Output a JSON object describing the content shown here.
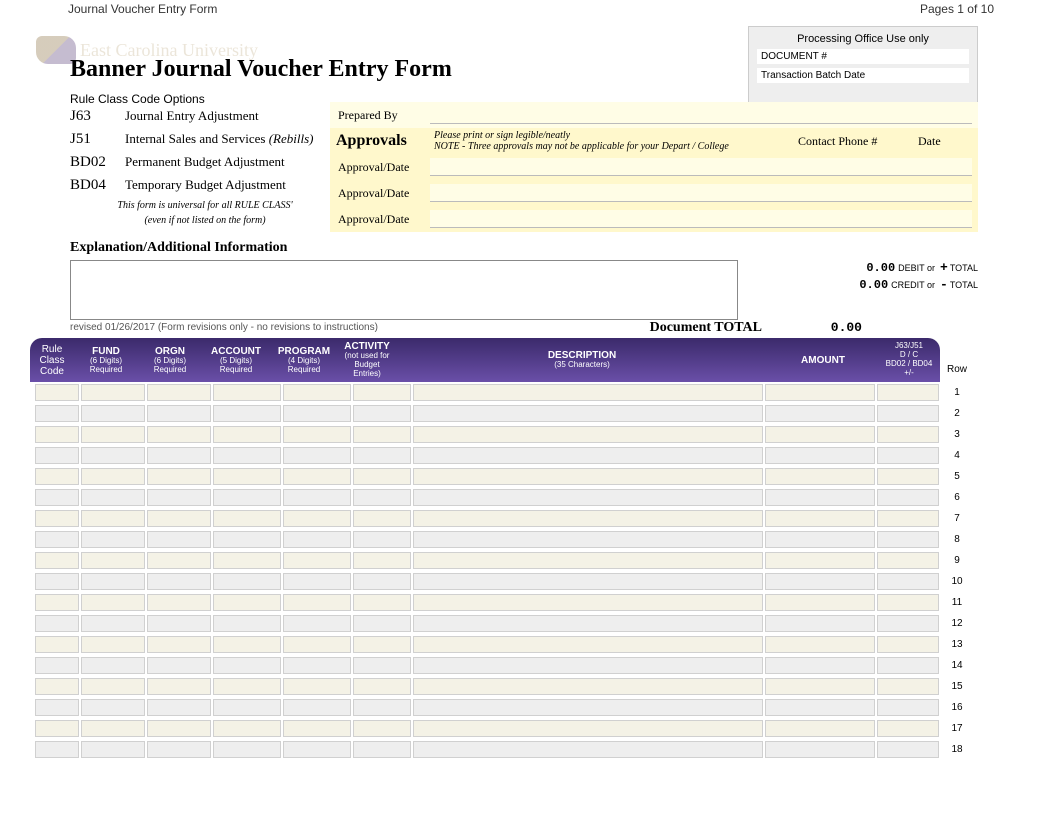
{
  "page_header": {
    "left": "Journal Voucher Entry Form",
    "right": "Pages 1 of 10"
  },
  "university": "East Carolina University",
  "title": "Banner Journal Voucher Entry Form",
  "processing_box": {
    "header": "Processing Office Use only",
    "doc_label": "DOCUMENT #",
    "batch_label": "Transaction Batch Date"
  },
  "rule_options_label": "Rule Class Code Options",
  "rules": [
    {
      "code": "J63",
      "desc": "Journal Entry Adjustment"
    },
    {
      "code": "J51",
      "desc": "Internal Sales and Services",
      "desc_em": "(Rebills)"
    },
    {
      "code": "BD02",
      "desc": "Permanent Budget Adjustment"
    },
    {
      "code": "BD04",
      "desc": "Temporary Budget Adjustment"
    }
  ],
  "rule_note_1": "This form is universal for all RULE CLASS'",
  "rule_note_2": "(even if not listed on the form)",
  "approvals": {
    "prepared_by": "Prepared By",
    "big_label": "Approvals",
    "hint1": "Please print or sign legible/neatly",
    "hint2": "NOTE - Three approvals may not be applicable for your Depart / College",
    "contact": "Contact Phone #",
    "date": "Date",
    "ad": "Approval/Date"
  },
  "explanation_heading": "Explanation/Additional Information",
  "revised": "revised 01/26/2017 (Form revisions only - no revisions to instructions)",
  "totals": {
    "debit_val": "0.00",
    "debit_tag": "DEBIT or",
    "debit_sign": "+",
    "tot_lbl": "TOTAL",
    "credit_val": "0.00",
    "credit_tag": "CREDIT or",
    "credit_sign": "-",
    "doc_total_label": "Document TOTAL",
    "doc_total_val": "0.00"
  },
  "grid": {
    "headers": {
      "rule": {
        "l1": "Rule",
        "l2": "Class",
        "l3": "Code"
      },
      "fund": {
        "t": "FUND",
        "sub": "(6 Digits)",
        "req": "Required"
      },
      "orgn": {
        "t": "ORGN",
        "sub": "(6 Digits)",
        "req": "Required"
      },
      "acct": {
        "t": "ACCOUNT",
        "sub": "(5 Digits)",
        "req": "Required"
      },
      "prog": {
        "t": "PROGRAM",
        "sub": "(4 Digits)",
        "req": "Required"
      },
      "actv": {
        "t": "ACTIVITY",
        "sub1": "(not used for",
        "sub2": "Budget Entries)"
      },
      "desc": {
        "t": "DESCRIPTION",
        "sub": "(35 Characters)"
      },
      "amt": {
        "t": "AMOUNT"
      },
      "dc": {
        "l1": "J63/J51",
        "l2": "D / C",
        "l3": "BD02 / BD04",
        "l4": "+/-"
      },
      "row": "Row"
    },
    "row_count": 18
  }
}
